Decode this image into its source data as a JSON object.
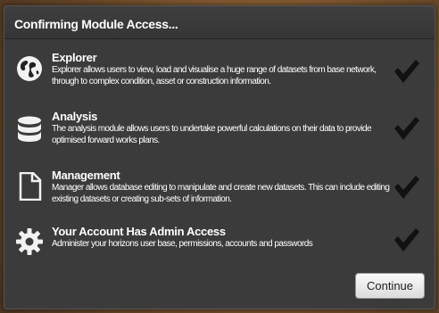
{
  "dialog": {
    "title": "Confirming Module Access...",
    "continue_label": "Continue"
  },
  "modules": [
    {
      "icon": "globe-icon",
      "name": "Explorer",
      "description": "Explorer allows users to view, load and visualise a huge range of datasets from base network, through to complex condition, asset or construction information."
    },
    {
      "icon": "database-icon",
      "name": "Analysis",
      "description": "The analysis module allows users to undertake powerful calculations on their data to provide optimised forward works plans."
    },
    {
      "icon": "document-icon",
      "name": "Management",
      "description": "Manager allows database editing to manipulate and create new datasets. This can include editing existing datasets or creating sub-sets of information."
    },
    {
      "icon": "gear-icon",
      "name": "Your Account Has Admin Access",
      "description": "Administer your horizons user base, permissions, accounts and passwords"
    }
  ]
}
